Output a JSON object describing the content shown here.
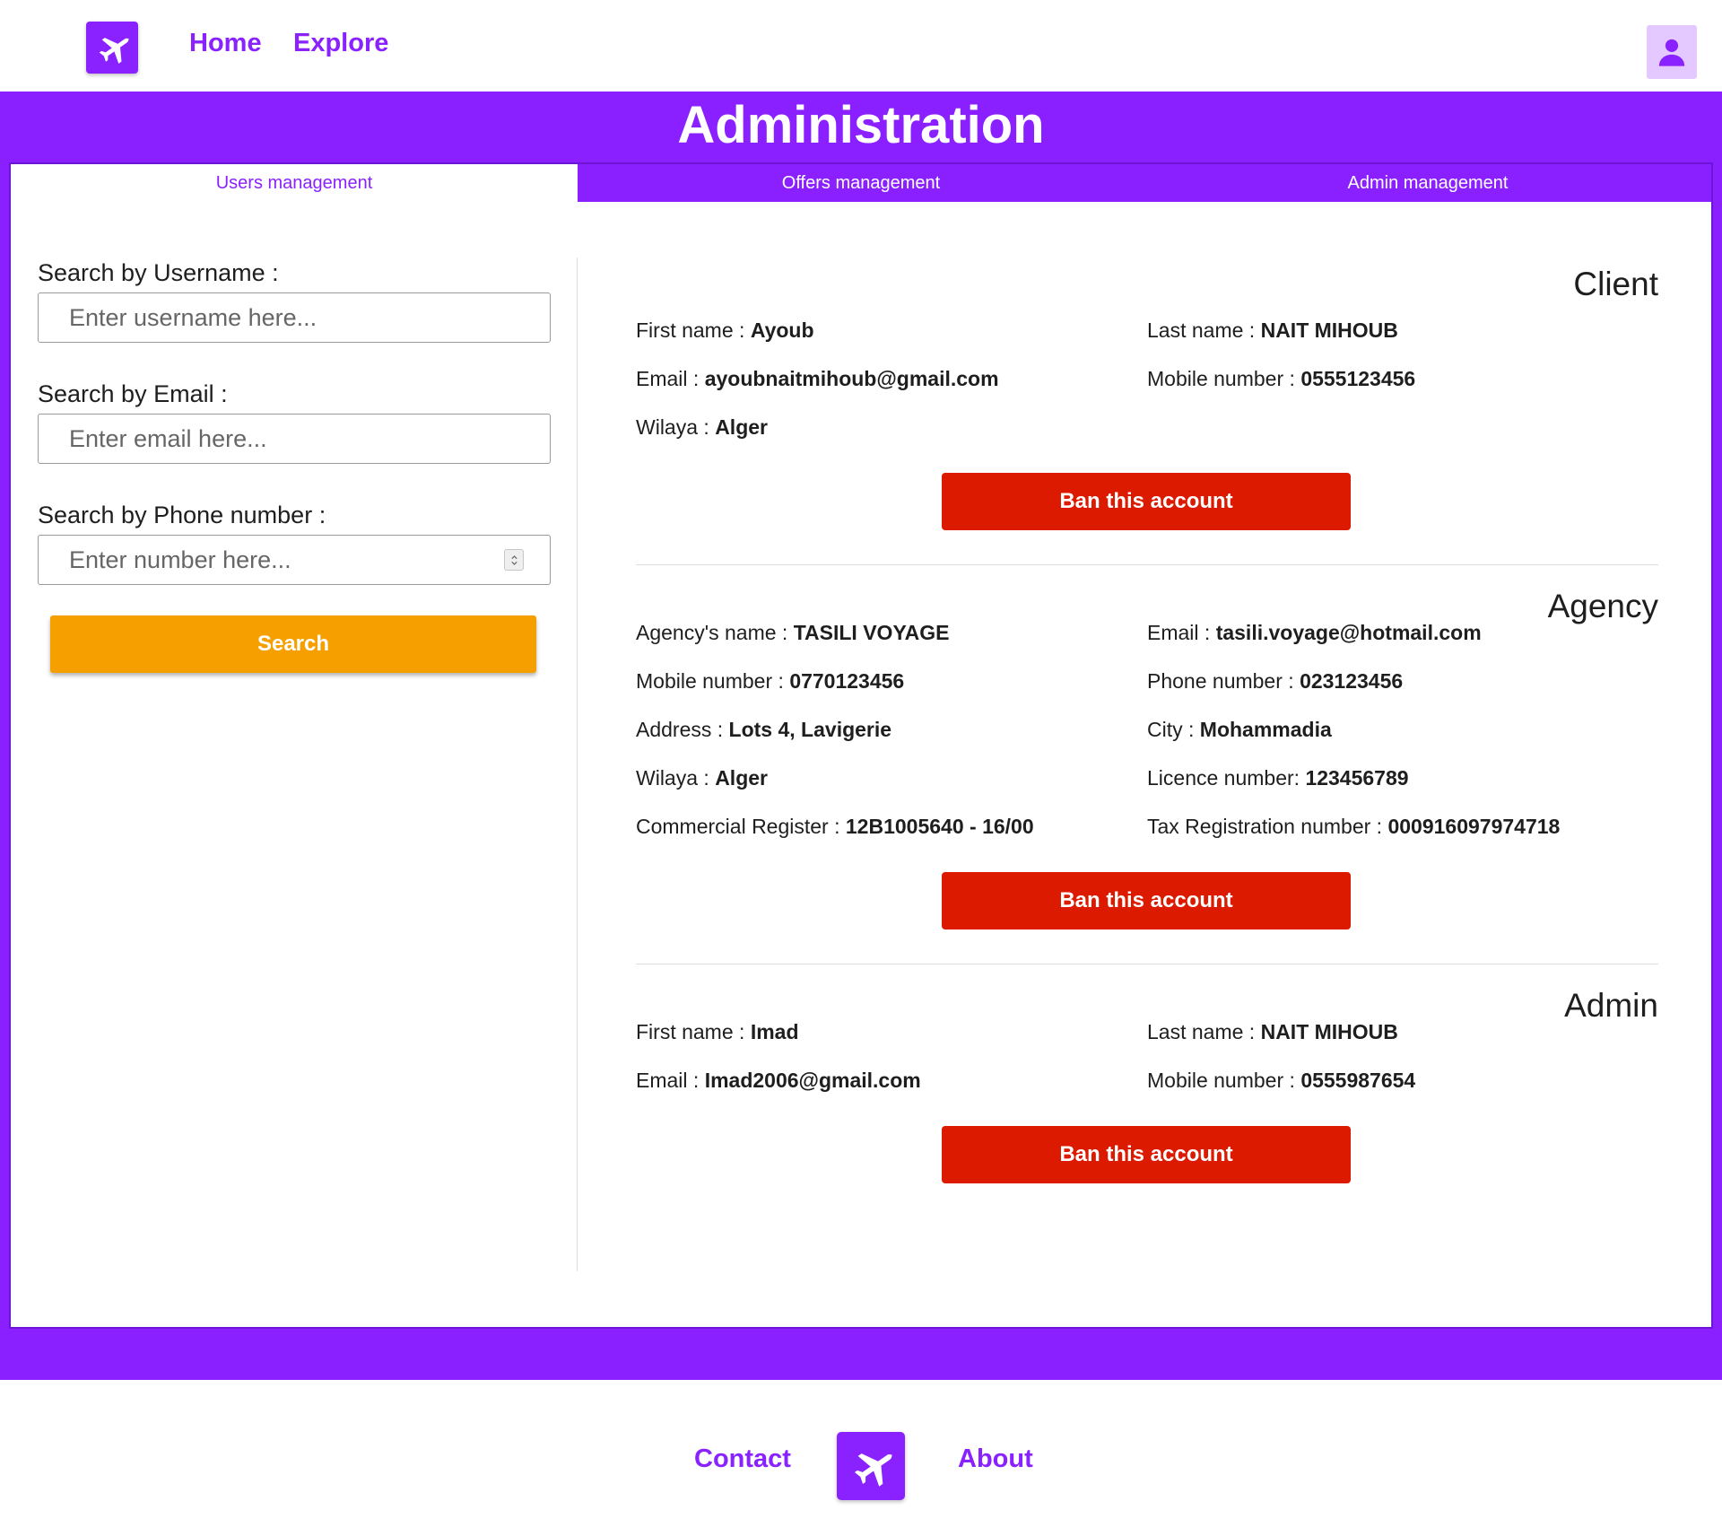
{
  "header": {
    "logo_icon": "airplane-icon",
    "nav": [
      {
        "label": "Home"
      },
      {
        "label": "Explore"
      }
    ],
    "profile_icon": "user-icon"
  },
  "page_title": "Administration",
  "tabs": [
    {
      "label": "Users management",
      "active": true
    },
    {
      "label": "Offers management",
      "active": false
    },
    {
      "label": "Admin management",
      "active": false
    }
  ],
  "search": {
    "username_label": "Search by Username :",
    "username_placeholder": "Enter username here...",
    "email_label": "Search by Email :",
    "email_placeholder": "Enter email here...",
    "phone_label": "Search by Phone number :",
    "phone_placeholder": "Enter number here...",
    "button_label": "Search"
  },
  "results": {
    "client": {
      "title": "Client",
      "fields": [
        {
          "label": "First name : ",
          "value": "Ayoub"
        },
        {
          "label": "Last name : ",
          "value": "NAIT MIHOUB"
        },
        {
          "label": "Email : ",
          "value": "ayoubnaitmihoub@gmail.com"
        },
        {
          "label": "Mobile number : ",
          "value": "0555123456"
        },
        {
          "label": "Wilaya : ",
          "value": "Alger"
        }
      ],
      "ban_label": "Ban this account"
    },
    "agency": {
      "title": "Agency",
      "fields": [
        {
          "label": "Agency's name : ",
          "value": "TASILI VOYAGE"
        },
        {
          "label": "Email : ",
          "value": "tasili.voyage@hotmail.com"
        },
        {
          "label": "Mobile number : ",
          "value": "0770123456"
        },
        {
          "label": "Phone number : ",
          "value": "023123456"
        },
        {
          "label": "Address : ",
          "value": "Lots 4, Lavigerie"
        },
        {
          "label": "City : ",
          "value": "Mohammadia"
        },
        {
          "label": "Wilaya : ",
          "value": "Alger"
        },
        {
          "label": "Licence number: ",
          "value": "123456789"
        },
        {
          "label": "Commercial Register : ",
          "value": "12B1005640 - 16/00"
        },
        {
          "label": "Tax Registration number : ",
          "value": "000916097974718"
        }
      ],
      "ban_label": "Ban this account"
    },
    "admin": {
      "title": "Admin",
      "fields": [
        {
          "label": "First name : ",
          "value": "Imad"
        },
        {
          "label": "Last name : ",
          "value": "NAIT MIHOUB"
        },
        {
          "label": "Email : ",
          "value": "Imad2006@gmail.com"
        },
        {
          "label": "Mobile number : ",
          "value": "0555987654"
        }
      ],
      "ban_label": "Ban this account"
    }
  },
  "footer": {
    "links": [
      {
        "label": "Contact"
      },
      {
        "label": "About"
      }
    ],
    "logo_icon": "airplane-icon"
  },
  "colors": {
    "primary": "#8a1fff",
    "search_button": "#f59f00",
    "ban_button": "#db1a00",
    "profile_bg": "#e3c9ff"
  }
}
